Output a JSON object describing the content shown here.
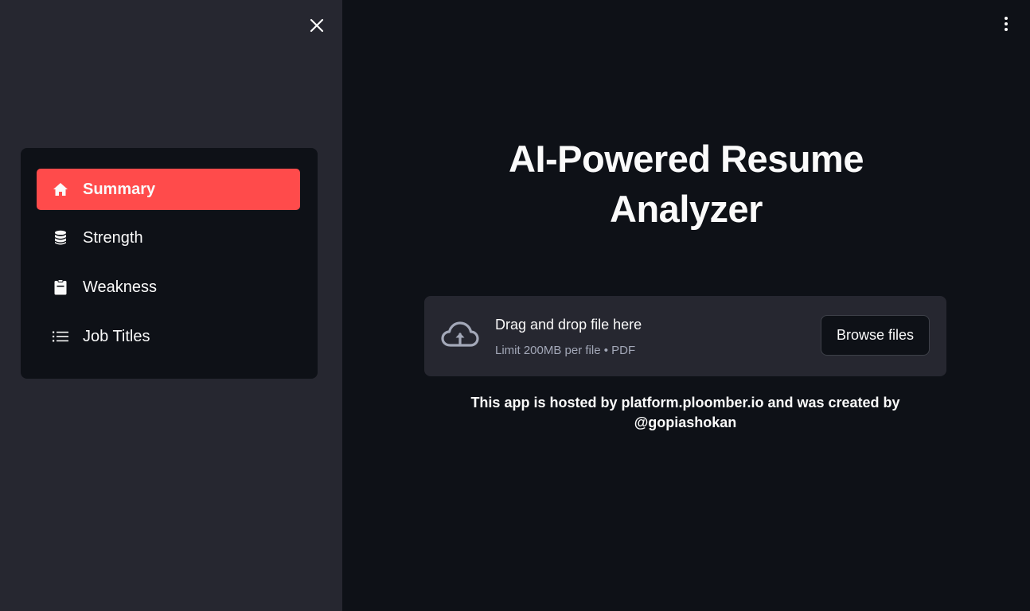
{
  "sidebar": {
    "close_icon": "close-icon",
    "nav": [
      {
        "label": "Summary",
        "icon": "home-icon",
        "active": true
      },
      {
        "label": "Strength",
        "icon": "database-icon",
        "active": false
      },
      {
        "label": "Weakness",
        "icon": "clipboard-icon",
        "active": false
      },
      {
        "label": "Job Titles",
        "icon": "list-icon",
        "active": false
      }
    ]
  },
  "header": {
    "menu_icon": "kebab-menu-icon"
  },
  "main": {
    "title_line1": "AI-Powered Resume",
    "title_line2": "Analyzer",
    "uploader": {
      "icon": "cloud-upload-icon",
      "drop_text": "Drag and drop file here",
      "limit_text": "Limit 200MB per file • PDF",
      "browse_label": "Browse files"
    },
    "footer_line1": "This app is hosted by platform.ploomber.io and was created by",
    "footer_line2": "@gopiashokan"
  },
  "colors": {
    "sidebar_bg": "#262730",
    "main_bg": "#0e1117",
    "accent": "#ff4b4b",
    "text": "#fafafa",
    "muted_text": "#a3a8b8"
  }
}
